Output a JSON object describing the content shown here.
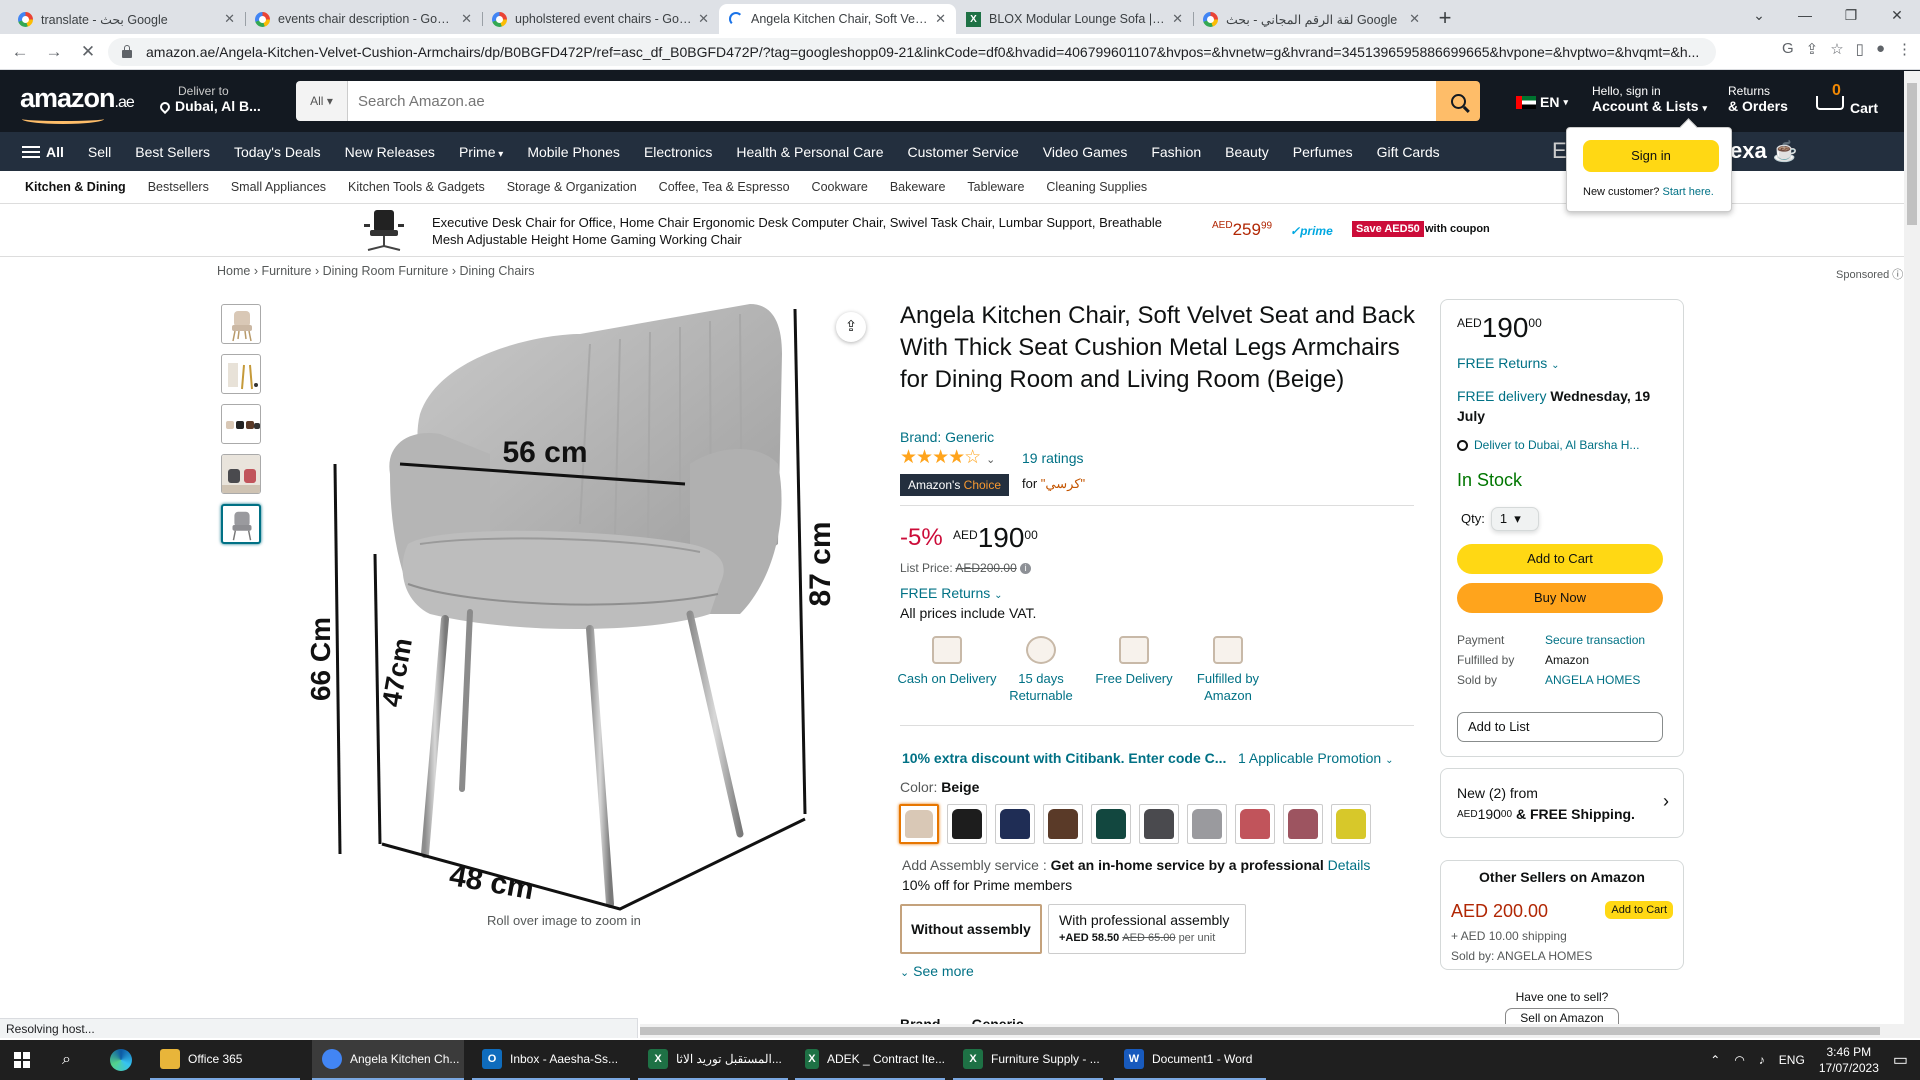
{
  "browser": {
    "tabs": [
      {
        "title": "translate - بحث Google",
        "icon": "google-icon"
      },
      {
        "title": "events chair description - Google",
        "icon": "google-icon"
      },
      {
        "title": "upholstered event chairs - Google",
        "icon": "google-icon"
      },
      {
        "title": "Angela Kitchen Chair, Soft Velvet",
        "icon": "loading-icon",
        "active": true
      },
      {
        "title": "BLOX Modular Lounge Sofa | Offi",
        "icon": "excel-icon"
      },
      {
        "title": "لقة الرقم المجاني - بحث Google",
        "icon": "google-icon"
      }
    ],
    "new_tab": "+",
    "window_controls": [
      "⌄",
      "—",
      "❐",
      "✕"
    ],
    "url": "amazon.ae/Angela-Kitchen-Velvet-Cushion-Armchairs/dp/B0BGFD472P/ref=asc_df_B0BGFD472P/?tag=googleshopp09-21&linkCode=df0&hvadid=406799601107&hvpos=&hvnetw=g&hvrand=3451396595886699665&hvpone=&hvptwo=&hvqmt=&h...",
    "status": "Resolving host..."
  },
  "header": {
    "logo": "amazon",
    "logo_tld": ".ae",
    "deliver_to": "Deliver to",
    "deliver_loc": "Dubai, Al B...",
    "search_scope": "All",
    "search_placeholder": "Search Amazon.ae",
    "lang": "EN",
    "hello": "Hello, sign in",
    "account": "Account & Lists",
    "returns": "Returns",
    "orders": "& Orders",
    "cart_count": "0",
    "cart": "Cart"
  },
  "nav": {
    "all": "All",
    "items": [
      "Sell",
      "Best Sellers",
      "Today's Deals",
      "New Releases",
      "Prime",
      "Mobile Phones",
      "Electronics",
      "Health & Personal Care",
      "Customer Service",
      "Video Games",
      "Fashion",
      "Beauty",
      "Perfumes",
      "Gift Cards"
    ],
    "alexa": "Alexa",
    "alexa_prefix": "E"
  },
  "signin_popover": {
    "button": "Sign in",
    "new_customer": "New customer?",
    "start_here": "Start here."
  },
  "subnav": [
    "Kitchen & Dining",
    "Bestsellers",
    "Small Appliances",
    "Kitchen Tools & Gadgets",
    "Storage & Organization",
    "Coffee, Tea & Espresso",
    "Cookware",
    "Bakeware",
    "Tableware",
    "Cleaning Supplies"
  ],
  "banner": {
    "text": "Executive Desk Chair for Office, Home Chair Ergonomic Desk Computer Chair, Swivel Task Chair, Lumbar Support, Breathable Mesh Adjustable Height Home Gaming Working Chair",
    "currency": "AED",
    "price": "259",
    "fraction": "99",
    "prime": "prime",
    "save": "Save AED50",
    "coupon": "with coupon"
  },
  "breadcrumb": [
    "Home",
    "Furniture",
    "Dining Room Furniture",
    "Dining Chairs"
  ],
  "sponsored": "Sponsored ⓘ",
  "gallery": {
    "zoom_hint": "Roll over image to zoom in",
    "dims": {
      "width": "56 cm",
      "height": "87 cm",
      "seat_height": "66 Cm",
      "leg": "47cm",
      "depth": "48 cm"
    }
  },
  "product": {
    "title": "Angela Kitchen Chair, Soft Velvet Seat and Back With Thick Seat Cushion Metal Legs Armchairs for Dining Room and Living Room (Beige)",
    "brand": "Brand: Generic",
    "rating_stars": "★★★★☆",
    "ratings": "19 ratings",
    "choice_a": "Amazon's",
    "choice_b": "Choice",
    "choice_for": "for",
    "choice_kw": "\"كرسي\"",
    "discount": "-5%",
    "currency": "AED",
    "price": "190",
    "fraction": "00",
    "list_label": "List Price:",
    "list_price": "AED200.00",
    "free_returns": "FREE Returns",
    "vat": "All prices include VAT.",
    "features": [
      {
        "label": "Cash on Delivery",
        "icon": "cash-icon"
      },
      {
        "label": "15 days Returnable",
        "icon": "return-icon"
      },
      {
        "label": "Free Delivery",
        "icon": "truck-icon"
      },
      {
        "label": "Fulfilled by Amazon",
        "icon": "box-icon"
      }
    ],
    "promo": "10% extra discount with Citibank. Enter code C...",
    "promo_count": "1 Applicable Promotion",
    "color_label": "Color:",
    "color_value": "Beige",
    "swatches": [
      "#d9c8b6",
      "#1d1d1d",
      "#1f2d55",
      "#5a3a28",
      "#12473f",
      "#4a4a4e",
      "#9a9a9e",
      "#c1545b",
      "#9d5460",
      "#d7c82a"
    ],
    "assembly_label": "Add Assembly service :",
    "assembly_bold": "Get an in-home service by a professional",
    "assembly_link": "Details",
    "prime_off": "10% off for Prime members",
    "opt_without": "Without assembly",
    "opt_with": "With professional assembly",
    "opt_price": "+AED 58.50",
    "opt_old": "AED 65.00",
    "opt_unit": "per unit",
    "see_more": "See more",
    "cut_row": "Brand        Generic"
  },
  "buybox": {
    "currency": "AED",
    "price": "190",
    "fraction": "00",
    "free_returns": "FREE Returns",
    "free_delivery": "FREE delivery",
    "delivery_date": "Wednesday, 19 July",
    "deliver_to": "Deliver to Dubai, Al Barsha H...",
    "stock": "In Stock",
    "qty_label": "Qty:",
    "qty": "1",
    "add_to_cart": "Add to Cart",
    "buy_now": "Buy Now",
    "rows": [
      {
        "k": "Payment",
        "v": "Secure transaction",
        "link": true
      },
      {
        "k": "Fulfilled by",
        "v": "Amazon",
        "link": false
      },
      {
        "k": "Sold by",
        "v": "ANGELA HOMES",
        "link": true
      }
    ],
    "add_to_list": "Add to List"
  },
  "new_offers": {
    "line1": "New (2) from",
    "currency": "AED",
    "price": "190",
    "fraction": "00",
    "shipping": "& FREE Shipping."
  },
  "other_sellers": {
    "heading": "Other Sellers on Amazon",
    "price": "AED 200.00",
    "add": "Add to Cart",
    "shipping": "+ AED 10.00 shipping",
    "sold_by": "Sold by: ANGELA HOMES"
  },
  "sell": {
    "question": "Have one to sell?",
    "button": "Sell on Amazon"
  },
  "taskbar": {
    "apps": [
      {
        "label": "Office 365",
        "icon": "folder-icon",
        "color": "#e8b53a"
      },
      {
        "label": "Angela Kitchen Ch...",
        "icon": "chrome-icon",
        "color": "#4285f4"
      },
      {
        "label": "Inbox - Aaesha-Ss...",
        "icon": "outlook-icon",
        "color": "#0f6cbd"
      },
      {
        "label": "المستقبل توريد الاثا...",
        "icon": "excel-icon",
        "color": "#1e7145"
      },
      {
        "label": "ADEK _ Contract Ite...",
        "icon": "excel-icon",
        "color": "#1e7145"
      },
      {
        "label": "Furniture Supply - ...",
        "icon": "excel-icon",
        "color": "#1e7145"
      },
      {
        "label": "Document1 - Word",
        "icon": "word-icon",
        "color": "#185abd"
      }
    ],
    "lang": "ENG",
    "time": "3:46 PM",
    "date": "17/07/2023"
  }
}
